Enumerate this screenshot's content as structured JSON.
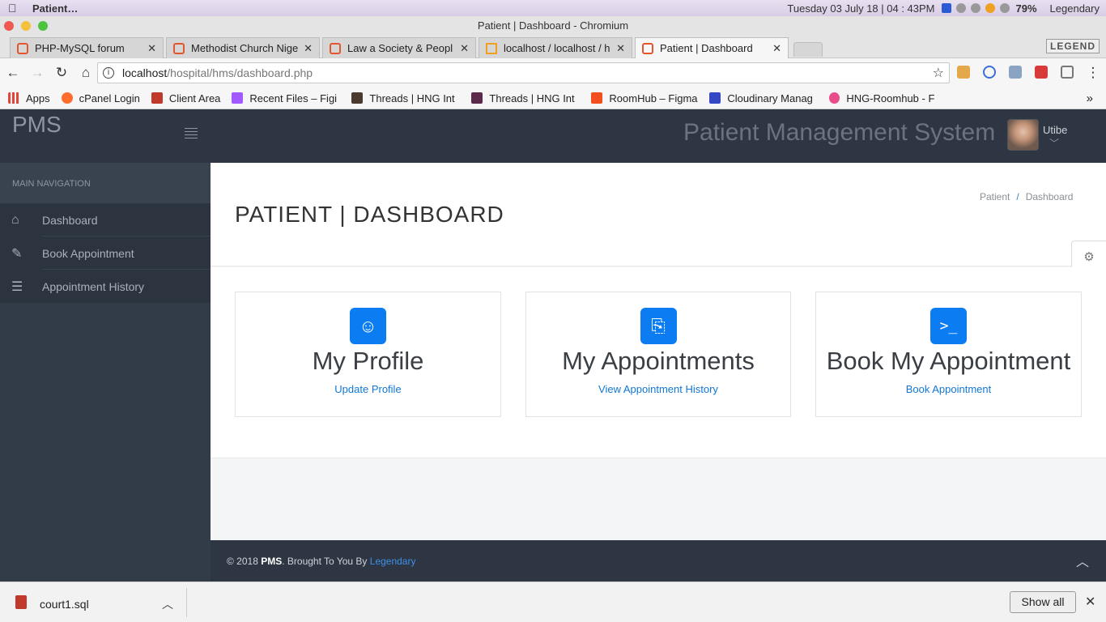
{
  "os": {
    "app_name": "Patient…",
    "datetime": "Tuesday 03 July 18 |  04 : 43PM",
    "battery": "79%",
    "user": "Legendary"
  },
  "window": {
    "title": "Patient | Dashboard - Chromium"
  },
  "tabs": [
    {
      "label": "PHP-MySQL forum"
    },
    {
      "label": "Methodist Church Nige"
    },
    {
      "label": "Law a Society & Peopl"
    },
    {
      "label": "localhost / localhost / h"
    },
    {
      "label": "Patient | Dashboard",
      "active": true
    }
  ],
  "legend_badge": "LEGEND",
  "address": {
    "host": "localhost",
    "path": "/hospital/hms/dashboard.php"
  },
  "bookmarks": [
    {
      "label": "Apps",
      "icon": "apps-grid-icon",
      "color": "#e0463a"
    },
    {
      "label": "cPanel Login",
      "icon": "cpanel-icon",
      "color": "#ff6c2c"
    },
    {
      "label": "Client Area",
      "icon": "shield-icon",
      "color": "#c0392b"
    },
    {
      "label": "Recent Files – Figi",
      "icon": "figma-icon",
      "color": "#a259ff"
    },
    {
      "label": "Threads | HNG Int",
      "icon": "hash-icon",
      "color": "#4a3b2e"
    },
    {
      "label": "Threads | HNG Int",
      "icon": "hash-icon",
      "color": "#5b2a4a"
    },
    {
      "label": "RoomHub – Figma",
      "icon": "figma-icon",
      "color": "#f24e1e"
    },
    {
      "label": "Cloudinary Manag",
      "icon": "cloud-icon",
      "color": "#3448c5"
    },
    {
      "label": "HNG-Roomhub - F",
      "icon": "dribbble-icon",
      "color": "#ea4c89"
    }
  ],
  "app": {
    "brand": "PMS",
    "system_name": "Patient Management System",
    "user_name": "Utibe"
  },
  "sidebar": {
    "heading": "MAIN NAVIGATION",
    "items": [
      {
        "label": "Dashboard",
        "icon": "home-icon"
      },
      {
        "label": "Book Appointment",
        "icon": "edit-icon"
      },
      {
        "label": "Appointment History",
        "icon": "list-icon"
      }
    ]
  },
  "page": {
    "title": "PATIENT | DASHBOARD",
    "breadcrumb": [
      "Patient",
      "Dashboard"
    ]
  },
  "cards": [
    {
      "title": "My Profile",
      "link": "Update Profile",
      "icon": "smile-icon"
    },
    {
      "title": "My Appointments",
      "link": "View Appointment History",
      "icon": "paperclip-icon"
    },
    {
      "title": "Book My Appointment",
      "link": "Book Appointment",
      "icon": "terminal-icon"
    }
  ],
  "footer": {
    "prefix": "© 2018 ",
    "brand": "PMS",
    "middle": ". Brought To You By ",
    "author": "Legendary"
  },
  "downloads": {
    "file": "court1.sql",
    "show_all": "Show all"
  },
  "colors": {
    "header": "#2e3643",
    "sidebar": "#323b48",
    "accent": "#0c7cf3",
    "link": "#1277d6"
  }
}
